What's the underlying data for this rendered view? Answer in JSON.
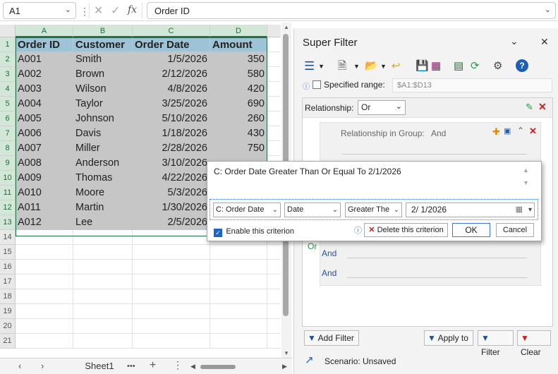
{
  "formula_bar": {
    "name_box": "A1",
    "formula": "Order ID",
    "fx_label": "fx"
  },
  "sheet": {
    "columns": [
      "A",
      "B",
      "C",
      "D"
    ],
    "rows": [
      "1",
      "2",
      "3",
      "4",
      "5",
      "6",
      "7",
      "8",
      "9",
      "10",
      "11",
      "12",
      "13",
      "14",
      "15",
      "16",
      "17",
      "18",
      "19",
      "20",
      "21"
    ],
    "header": [
      "Order ID",
      "Customer",
      "Order Date",
      "Amount"
    ],
    "data": [
      [
        "A001",
        "Smith",
        "1/5/2026",
        "350"
      ],
      [
        "A002",
        "Brown",
        "2/12/2026",
        "580"
      ],
      [
        "A003",
        "Wilson",
        "4/8/2026",
        "420"
      ],
      [
        "A004",
        "Taylor",
        "3/25/2026",
        "690"
      ],
      [
        "A005",
        "Johnson",
        "5/10/2026",
        "260"
      ],
      [
        "A006",
        "Davis",
        "1/18/2026",
        "430"
      ],
      [
        "A007",
        "Miller",
        "2/28/2026",
        "750"
      ],
      [
        "A008",
        "Anderson",
        "3/10/2026",
        ""
      ],
      [
        "A009",
        "Thomas",
        "4/22/2026",
        ""
      ],
      [
        "A010",
        "Moore",
        "5/3/2026",
        ""
      ],
      [
        "A011",
        "Martin",
        "1/30/2026",
        ""
      ],
      [
        "A012",
        "Lee",
        "2/5/2026",
        ""
      ]
    ],
    "tab_name": "Sheet1",
    "tab_more": "•••"
  },
  "pane": {
    "title": "Super Filter",
    "specified_range_label": "Specified range:",
    "specified_range_value": "$A1:$D13",
    "relationship_label": "Relationship:",
    "relationship_value": "Or",
    "group_label": "Relationship in Group:",
    "group_value": "And",
    "or_label": "Or",
    "and_label": "And",
    "buttons": {
      "add_filter": "Add Filter",
      "apply_to": "Apply to",
      "filter": "Filter",
      "clear": "Clear"
    },
    "scenario_label": "Scenario:",
    "scenario_value": "Unsaved"
  },
  "popup": {
    "description": "C: Order Date  Greater Than Or Equal To  2/1/2026",
    "column_select": "C: Order Date",
    "type_select": "Date",
    "operator_select": "Greater The",
    "date_value": "2/  1/2026",
    "enable_label": "Enable this criterion",
    "delete_label": "Delete this criterion",
    "ok_label": "OK",
    "cancel_label": "Cancel"
  },
  "colors": {
    "accent_green": "#217346",
    "header_fill": "#9fc3d6",
    "selection_fill": "#c6c6c6"
  }
}
